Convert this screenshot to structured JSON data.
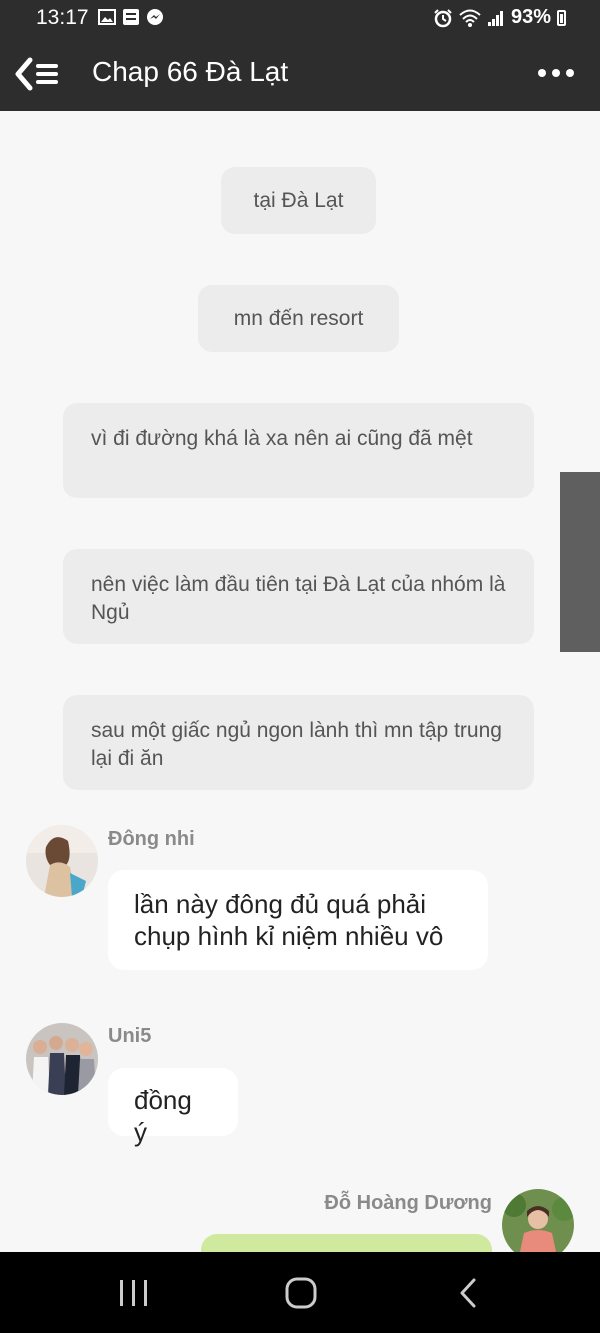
{
  "status_bar": {
    "time": "13:17",
    "battery": "93%"
  },
  "header": {
    "title": "Chap 66 Đà Lạt"
  },
  "narration": [
    "tại Đà Lạt",
    "mn đến resort",
    "vì đi đường khá là xa nên ai cũng đã mệt",
    "nên việc làm đầu tiên tại Đà Lạt của nhóm là Ngủ",
    "sau một giấc ngủ ngon lành thì mn tập trung lại đi ăn"
  ],
  "messages": [
    {
      "sender": "Đông nhi",
      "text": "lần này đông đủ quá phải chụp hình kỉ niệm nhiều vô"
    },
    {
      "sender": "Uni5",
      "text": "đồng ý"
    },
    {
      "sender": "Đỗ Hoàng Dương",
      "text": ""
    }
  ],
  "colors": {
    "bar_bg": "#2d2d2d",
    "content_bg": "#f7f7f7",
    "narration_bubble": "#ececec",
    "incoming_bubble": "#ffffff",
    "outgoing_bubble": "#cfe99f"
  }
}
